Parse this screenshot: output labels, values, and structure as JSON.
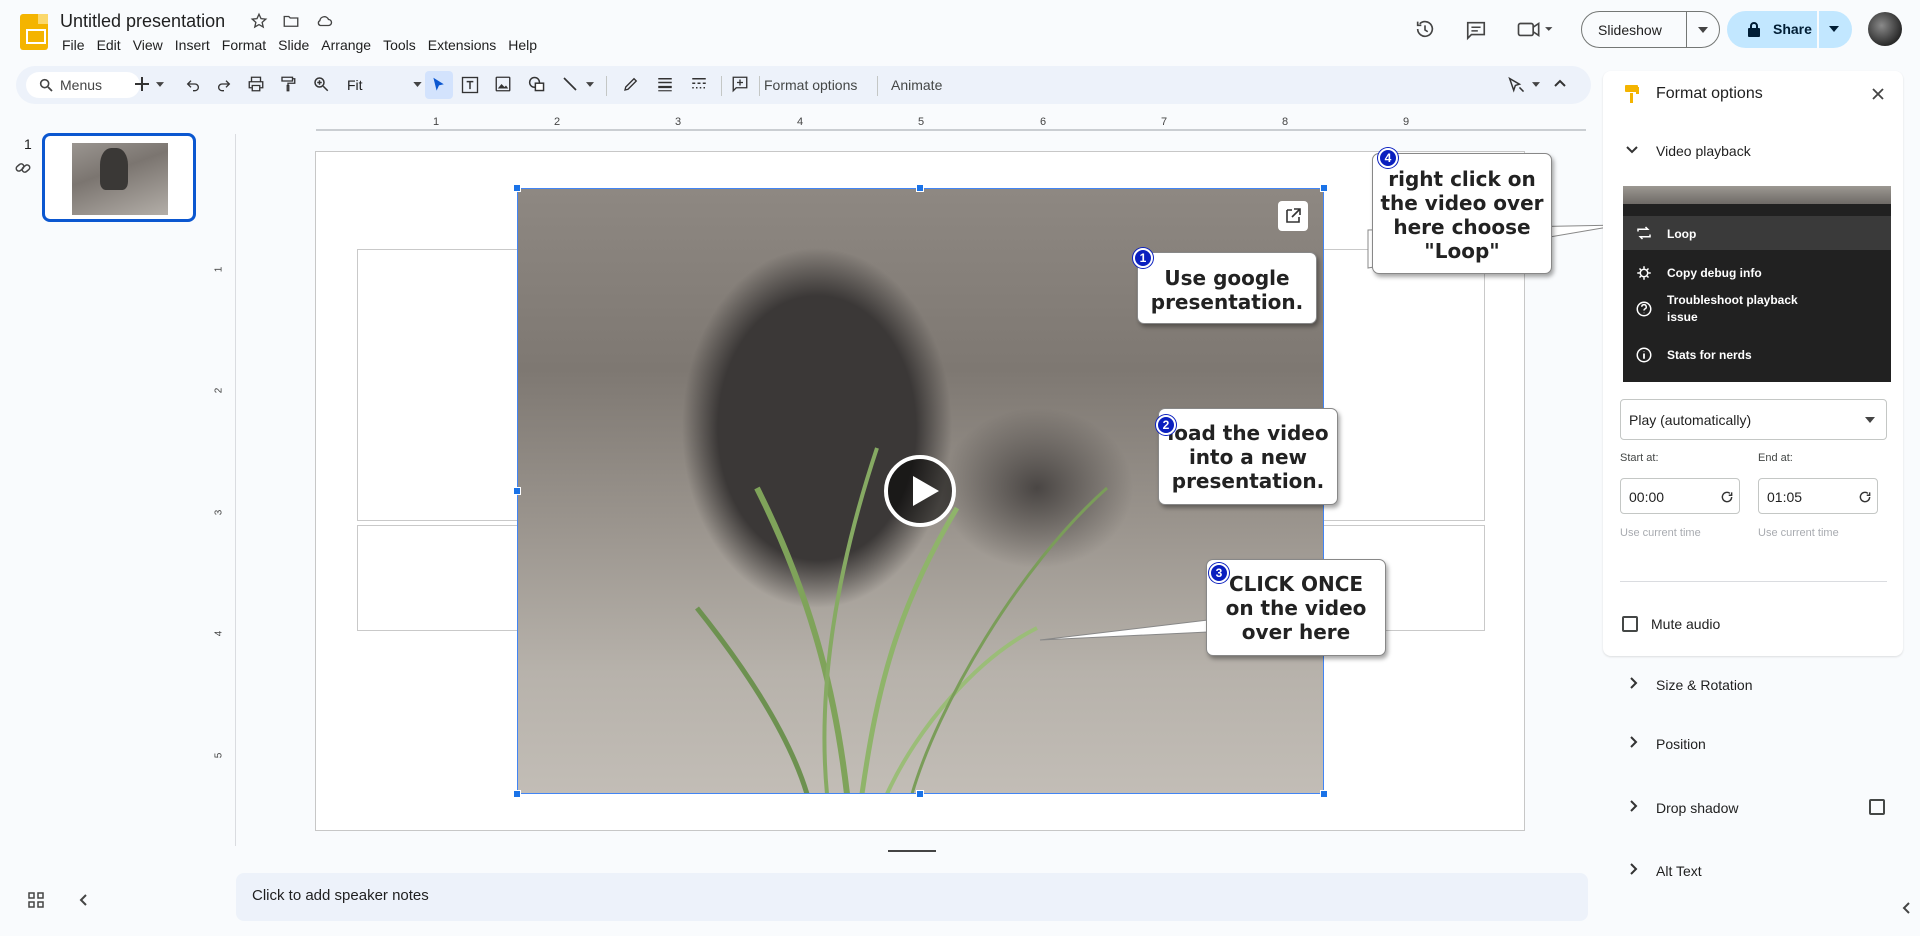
{
  "app": {
    "doc_title": "Untitled presentation",
    "menus": [
      "File",
      "Edit",
      "View",
      "Insert",
      "Format",
      "Slide",
      "Arrange",
      "Tools",
      "Extensions",
      "Help"
    ],
    "slideshow_label": "Slideshow",
    "share_label": "Share"
  },
  "toolbar": {
    "search_label": "Menus",
    "zoom_value": "Fit",
    "format_options_label": "Format options",
    "animate_label": "Animate"
  },
  "filmstrip": {
    "slide_number": "1"
  },
  "rulers": {
    "h_ticks": [
      "1",
      "2",
      "3",
      "4",
      "5",
      "6",
      "7",
      "8",
      "9"
    ],
    "v_ticks": [
      "1",
      "2",
      "3",
      "4",
      "5"
    ]
  },
  "callouts": [
    {
      "number": "1",
      "lines": [
        "Use google",
        "presentation."
      ]
    },
    {
      "number": "2",
      "lines": [
        "load the video",
        "into a new",
        "presentation."
      ]
    },
    {
      "number": "3",
      "lines": [
        "CLICK ONCE",
        "on the video",
        "over here"
      ]
    },
    {
      "number": "4",
      "lines": [
        "right click on",
        "the video over",
        "here choose",
        "\"Loop\""
      ]
    }
  ],
  "notes": {
    "placeholder": "Click to add speaker notes"
  },
  "panel": {
    "title": "Format options",
    "video_playback_label": "Video playback",
    "context_menu": [
      "Loop",
      "Copy debug info",
      "Troubleshoot playback",
      "issue",
      "Stats for nerds"
    ],
    "play_mode": "Play (automatically)",
    "start_label": "Start at:",
    "end_label": "End at:",
    "start_value": "00:00",
    "end_value": "01:05",
    "use_current": "Use current time",
    "mute_label": "Mute audio",
    "sections": [
      "Size & Rotation",
      "Position",
      "Drop shadow",
      "Alt Text"
    ]
  }
}
